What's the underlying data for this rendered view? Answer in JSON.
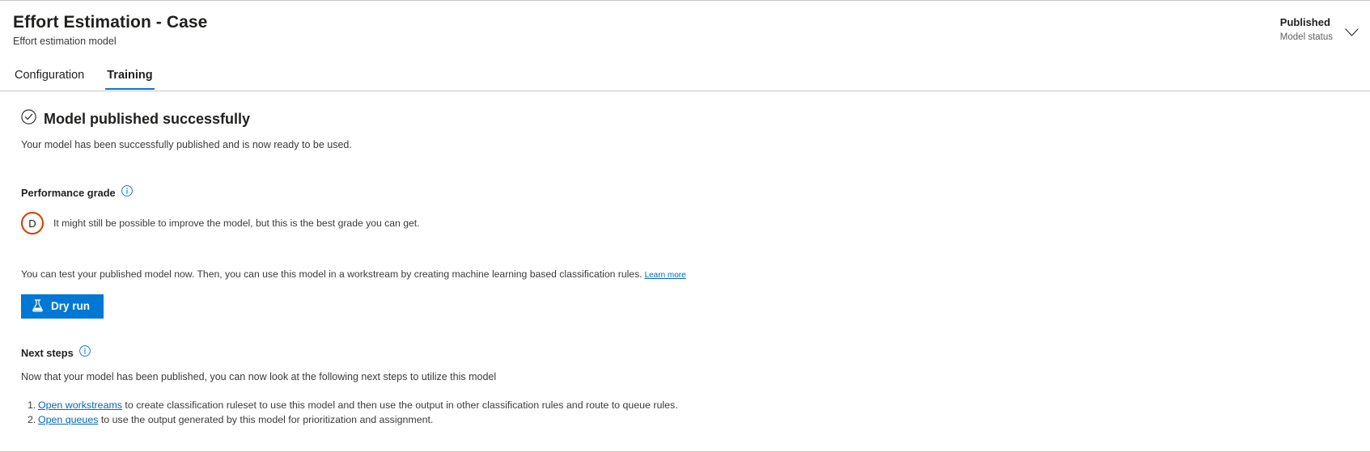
{
  "header": {
    "title": "Effort Estimation - Case",
    "subtitle": "Effort estimation model",
    "status_value": "Published",
    "status_label": "Model status",
    "chevron_icon": "chevron-down-icon",
    "tabs": [
      {
        "label": "Configuration",
        "active": false
      },
      {
        "label": "Training",
        "active": true
      }
    ]
  },
  "banner": {
    "icon": "check-circle-icon",
    "title": "Model published successfully",
    "subtitle": "Your model has been successfully published and is now ready to be used."
  },
  "performance": {
    "section_label": "Performance grade",
    "info_icon": "info-icon",
    "grade": "D",
    "grade_color": "#d83b01",
    "grade_description": "It might still be possible to improve the model, but this is the best grade you can get."
  },
  "test": {
    "paragraph": "You can test your published model now. Then, you can use this model in a workstream by creating machine learning based classification rules.",
    "learn_more_label": "Learn more",
    "dry_run_label": "Dry run",
    "dry_run_icon": "flask-icon",
    "dry_run_color": "#0078d4"
  },
  "next_steps": {
    "section_label": "Next steps",
    "info_icon": "info-icon",
    "subtitle": "Now that your model has been published, you can now look at the following next steps to utilize this model",
    "items": [
      {
        "link": "Open workstreams",
        "text": " to create classification ruleset to use this model and then use the output in other classification rules and route to queue rules."
      },
      {
        "link": "Open queues",
        "text": " to use the output generated by this model for prioritization and assignment."
      }
    ]
  },
  "colors": {
    "accent": "#0078d4",
    "link": "#0067b8",
    "warning": "#d83b01"
  }
}
